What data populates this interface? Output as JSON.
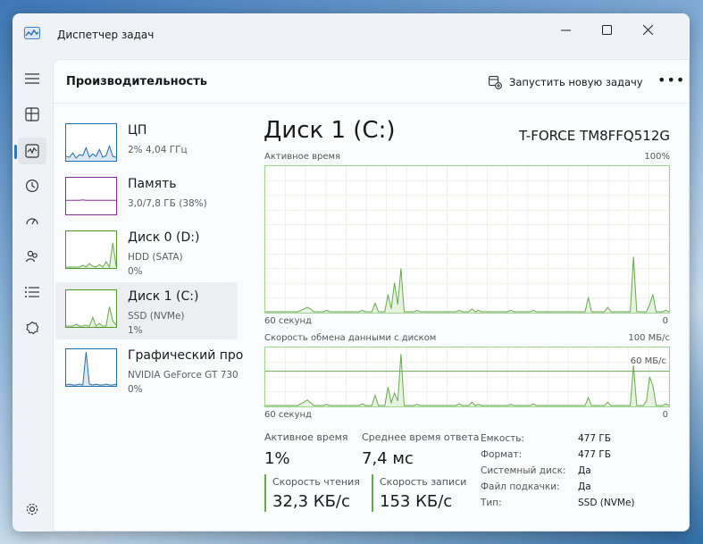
{
  "window": {
    "title": "Диспетчер задач",
    "minimize_icon": "minimize-icon",
    "maximize_icon": "maximize-icon",
    "close_icon": "close-icon"
  },
  "nav": {
    "items": [
      {
        "name": "hamburger-menu",
        "icon": "menu-icon"
      },
      {
        "name": "processes",
        "icon": "processes-icon"
      },
      {
        "name": "performance",
        "icon": "performance-icon",
        "active": true
      },
      {
        "name": "app-history",
        "icon": "history-icon"
      },
      {
        "name": "startup",
        "icon": "startup-icon"
      },
      {
        "name": "users",
        "icon": "users-icon"
      },
      {
        "name": "details",
        "icon": "details-icon"
      },
      {
        "name": "services",
        "icon": "services-icon"
      },
      {
        "name": "settings",
        "icon": "gear-icon"
      }
    ]
  },
  "header": {
    "title": "Производительность",
    "run_task": "Запустить новую задачу",
    "more": "•••"
  },
  "sidebar": {
    "items": [
      {
        "name": "ЦП",
        "sub1": "2% 4,04 ГГц",
        "sub2": "",
        "color": "#1f6fb0"
      },
      {
        "name": "Память",
        "sub1": "3,0/7,8 ГБ (38%)",
        "sub2": "",
        "color": "#8b2a9b"
      },
      {
        "name": "Диск 0 (D:)",
        "sub1": "HDD (SATA)",
        "sub2": "0%",
        "color": "#4d9a2a"
      },
      {
        "name": "Диск 1 (C:)",
        "sub1": "SSD (NVMe)",
        "sub2": "1%",
        "color": "#4d9a2a"
      },
      {
        "name": "Графический про",
        "sub1": "NVIDIA GeForce GT 730",
        "sub2": "0%",
        "color": "#1f6fb0"
      }
    ]
  },
  "detail": {
    "title": "Диск 1 (C:)",
    "model": "T-FORCE TM8FFQ512G",
    "active_time_label": "Активное время",
    "active_time_max": "100%",
    "active_time_seconds": "60 секунд",
    "active_time_min": "0",
    "transfer_label": "Скорость обмена данными с диском",
    "transfer_max": "100 МБ/с",
    "transfer_line_label": "60 МБ/с",
    "transfer_seconds": "60 секунд",
    "transfer_min": "0",
    "stats": {
      "active_time_label": "Активное время",
      "active_time_value": "1%",
      "avg_response_label": "Среднее время ответа",
      "avg_response_value": "7,4 мс",
      "read_label": "Скорость чтения",
      "read_value": "32,3 КБ/с",
      "write_label": "Скорость записи",
      "write_value": "153 КБ/с"
    },
    "info": [
      {
        "key": "Емкость:",
        "value": "477 ГБ"
      },
      {
        "key": "Формат:",
        "value": "477 ГБ"
      },
      {
        "key": "Системный диск:",
        "value": "Да"
      },
      {
        "key": "Файл подкачки:",
        "value": "Да"
      },
      {
        "key": "Тип:",
        "value": "SSD (NVMe)"
      }
    ]
  },
  "colors": {
    "disk_line": "#6aa84f",
    "disk_fill": "#e6f3df",
    "cpu_line": "#1f6fb0",
    "mem_line": "#8b2a9b"
  },
  "graphs": {
    "active_time_pct": [
      0,
      0,
      0,
      0,
      0,
      0,
      0,
      0,
      0,
      0,
      0,
      1,
      2,
      3,
      2,
      0,
      0,
      0,
      0,
      1,
      0,
      0,
      0,
      0,
      0,
      0,
      0,
      0,
      0,
      0,
      1,
      0,
      0,
      0,
      6,
      0,
      0,
      0,
      12,
      2,
      20,
      5,
      30,
      0,
      0,
      0,
      0,
      1,
      0,
      0,
      0,
      0,
      0,
      0,
      0,
      0,
      0,
      0,
      0,
      0,
      1,
      0,
      0,
      0,
      2,
      0,
      1,
      0,
      0,
      0,
      0,
      0,
      0,
      0,
      0,
      0,
      1,
      0,
      0,
      0,
      0,
      0,
      0,
      1,
      0,
      0,
      0,
      0,
      0,
      0,
      0,
      0,
      0,
      0,
      0,
      0,
      0,
      0,
      0,
      0,
      10,
      0,
      0,
      0,
      0,
      0,
      3,
      0,
      0,
      0,
      0,
      0,
      0,
      0,
      38,
      0,
      0,
      0,
      0,
      5,
      12,
      0,
      0,
      0,
      1,
      0
    ],
    "transfer_mbps": [
      0,
      0,
      0,
      0,
      0,
      0,
      0,
      0,
      0,
      0,
      0,
      3,
      6,
      10,
      5,
      0,
      0,
      0,
      0,
      2,
      0,
      0,
      0,
      0,
      0,
      0,
      0,
      0,
      0,
      0,
      3,
      0,
      0,
      0,
      18,
      0,
      0,
      0,
      32,
      5,
      22,
      8,
      90,
      0,
      0,
      0,
      0,
      2,
      0,
      0,
      0,
      0,
      0,
      0,
      0,
      0,
      0,
      0,
      0,
      0,
      3,
      0,
      0,
      0,
      6,
      0,
      2,
      0,
      0,
      0,
      0,
      0,
      0,
      0,
      0,
      0,
      2,
      0,
      0,
      0,
      0,
      0,
      0,
      3,
      0,
      0,
      0,
      0,
      0,
      0,
      0,
      0,
      0,
      0,
      0,
      0,
      0,
      0,
      0,
      0,
      14,
      0,
      0,
      0,
      0,
      0,
      6,
      0,
      0,
      0,
      0,
      0,
      0,
      0,
      70,
      0,
      0,
      0,
      8,
      50,
      35,
      0,
      0,
      0,
      3,
      0
    ],
    "transfer_line_value": 60,
    "thumb_cpu": [
      4,
      3,
      8,
      2,
      6,
      5,
      14,
      3,
      7,
      4,
      12,
      3,
      5,
      16,
      4,
      3
    ],
    "thumb_mem": [
      38,
      38,
      38,
      38,
      38,
      39,
      38,
      38,
      38,
      38,
      38,
      38,
      38,
      38,
      38,
      38
    ],
    "thumb_d0": [
      0,
      0,
      0,
      0,
      0,
      2,
      0,
      4,
      1,
      0,
      3,
      0,
      6,
      0,
      28,
      1
    ],
    "thumb_d1": [
      0,
      0,
      0,
      2,
      0,
      0,
      1,
      0,
      10,
      0,
      3,
      0,
      0,
      22,
      6,
      1
    ],
    "thumb_gpu": [
      0,
      1,
      0,
      0,
      1,
      0,
      38,
      1,
      0,
      1,
      0,
      0,
      1,
      0,
      0,
      1
    ]
  }
}
